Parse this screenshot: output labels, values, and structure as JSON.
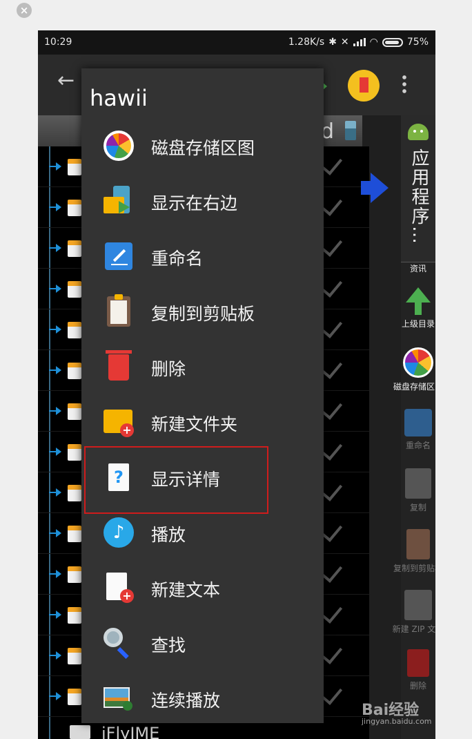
{
  "status_bar": {
    "time": "10:29",
    "network_speed": "1.28K/s",
    "battery": "75%",
    "icons": [
      "bluetooth-icon",
      "mute-vibrate-icon",
      "signal-icon",
      "wifi-icon",
      "battery-icon"
    ]
  },
  "toolbar": {
    "back_icon": "back-arrow-icon",
    "bookmark_icon": "bookmark-icon",
    "more_icon": "more-vert-icon"
  },
  "path_bar": {
    "visible_text": "d"
  },
  "side_panel": {
    "app_title": "应用程序…",
    "items": [
      {
        "label": "资讯"
      },
      {
        "label": "上级目录"
      },
      {
        "label": "磁盘存储区图"
      },
      {
        "label": "重命名"
      },
      {
        "label": "复制"
      },
      {
        "label": "复制到剪贴板"
      },
      {
        "label": "新建 ZIP 文件"
      },
      {
        "label": "删除"
      }
    ]
  },
  "file_list": {
    "last_visible_folder": "iFlyIME"
  },
  "context_menu": {
    "title": "hawii",
    "items": [
      {
        "label": "磁盘存储区图",
        "icon": "disk-map-icon"
      },
      {
        "label": "显示在右边",
        "icon": "show-right-icon"
      },
      {
        "label": "重命名",
        "icon": "rename-icon"
      },
      {
        "label": "复制到剪贴板",
        "icon": "clipboard-icon"
      },
      {
        "label": "删除",
        "icon": "trash-icon"
      },
      {
        "label": "新建文件夹",
        "icon": "new-folder-icon"
      },
      {
        "label": "显示详情",
        "icon": "file-details-icon",
        "highlighted": true
      },
      {
        "label": "播放",
        "icon": "music-icon"
      },
      {
        "label": "新建文本",
        "icon": "new-text-icon"
      },
      {
        "label": "查找",
        "icon": "search-icon"
      },
      {
        "label": "连续播放",
        "icon": "slideshow-icon"
      }
    ]
  },
  "colors": {
    "highlight_border": "#d01c1c",
    "menu_background": "#333333"
  },
  "watermark": {
    "brand": "Bai经验",
    "url": "jingyan.baidu.com"
  }
}
